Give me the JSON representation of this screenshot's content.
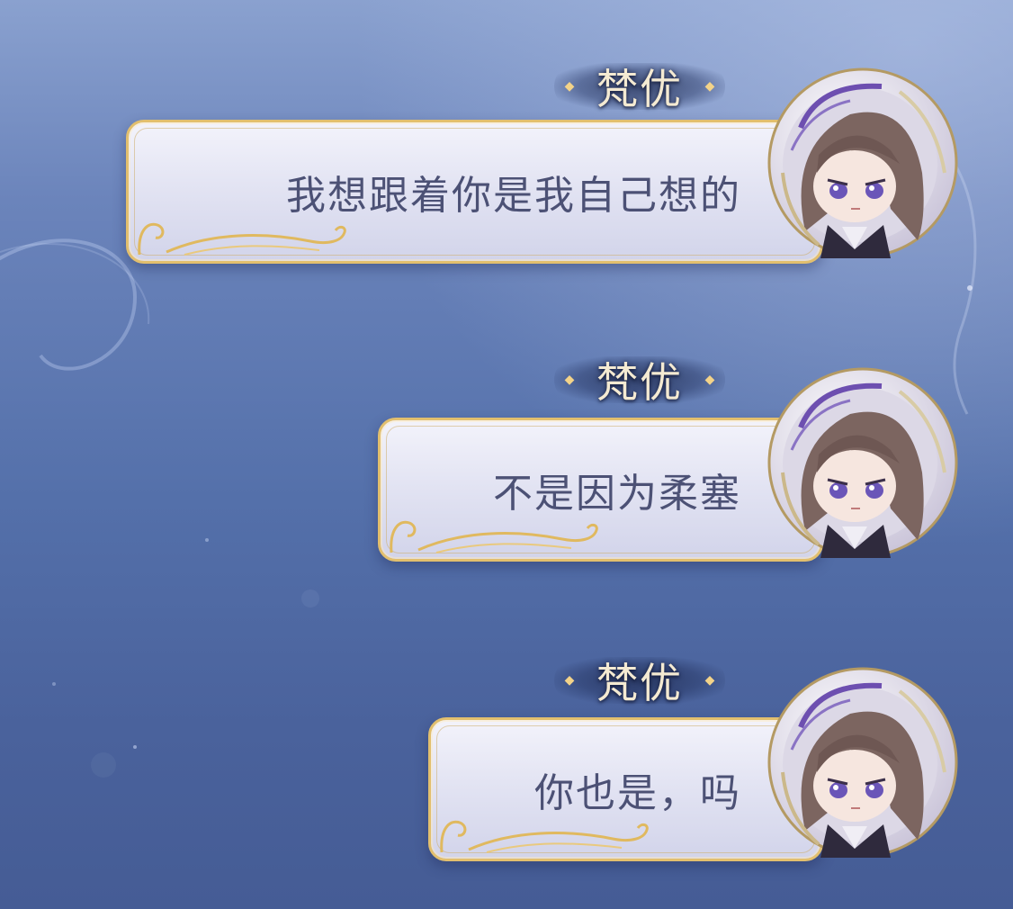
{
  "messages": [
    {
      "speaker": "梵优",
      "text": "我想跟着你是我自己想的"
    },
    {
      "speaker": "梵优",
      "text": "不是因为柔塞"
    },
    {
      "speaker": "梵优",
      "text": "你也是，吗"
    }
  ],
  "icons": {
    "speaker_decoration": "diamond-sparkle-icon",
    "avatar": "chibi-character-avatar",
    "bubble_ornament": "gold-flourish-icon"
  },
  "colors": {
    "background_top": "#8aa1cf",
    "background_bottom": "#455c95",
    "bubble_border": "#e2bf6e",
    "bubble_fill": "#e3e4f3",
    "message_text": "#4c5175",
    "speaker_text": "#f4ead2"
  }
}
